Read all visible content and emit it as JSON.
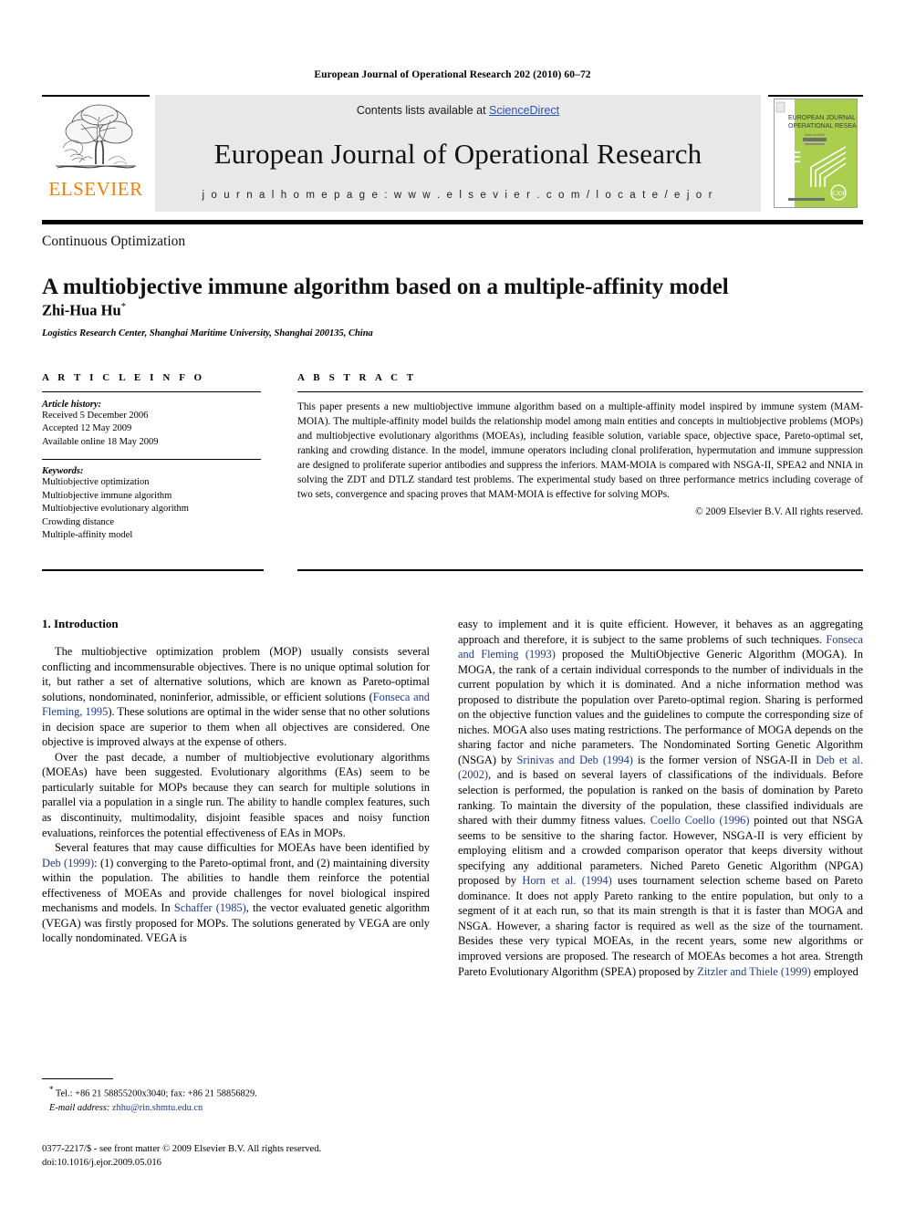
{
  "running_head": "European Journal of Operational Research 202 (2010) 60–72",
  "masthead": {
    "publisher_name": "ELSEVIER",
    "contents_prefix": "Contents lists available at ",
    "sciencedirect": "ScienceDirect",
    "journal_title": "European Journal of Operational Research",
    "homepage": "j o u r n a l   h o m e p a g e :   w w w . e l s e v i e r . c o m / l o c a t e / e j o r",
    "cover": {
      "line1": "EUROPEAN JOURNAL OF",
      "line2": "OPERATIONAL RESEARCH",
      "badge": "EJOR"
    },
    "link_color": "#2a53b8",
    "brand_color": "#F07F09",
    "cover_color": "#a8cc46"
  },
  "section_tag": "Continuous Optimization",
  "title": "A multiobjective immune algorithm based on a multiple-affinity model",
  "author": "Zhi-Hua Hu",
  "author_marker": "*",
  "affiliation": "Logistics Research Center, Shanghai Maritime University, Shanghai 200135, China",
  "article_info": {
    "heading": "A R T I C L E    I N F O",
    "history_label": "Article history:",
    "history": [
      "Received 5 December 2006",
      "Accepted 12 May 2009",
      "Available online 18 May 2009"
    ],
    "keywords_label": "Keywords:",
    "keywords": [
      "Multiobjective optimization",
      "Multiobjective immune algorithm",
      "Multiobjective evolutionary algorithm",
      "Crowding distance",
      "Multiple-affinity model"
    ]
  },
  "abstract": {
    "heading": "A B S T R A C T",
    "text": "This paper presents a new multiobjective immune algorithm based on a multiple-affinity model inspired by immune system (MAM-MOIA). The multiple-affinity model builds the relationship model among main entities and concepts in multiobjective problems (MOPs) and multiobjective evolutionary algorithms (MOEAs), including feasible solution, variable space, objective space, Pareto-optimal set, ranking and crowding distance. In the model, immune operators including clonal proliferation, hypermutation and immune suppression are designed to proliferate superior antibodies and suppress the inferiors. MAM-MOIA is compared with NSGA-II, SPEA2 and NNIA in solving the ZDT and DTLZ standard test problems. The experimental study based on three performance metrics including coverage of two sets, convergence and spacing proves that MAM-MOIA is effective for solving MOPs.",
    "copyright": "© 2009 Elsevier B.V. All rights reserved."
  },
  "body": {
    "section_number_title": "1. Introduction",
    "left_paragraphs": [
      "The multiobjective optimization problem (MOP) usually consists several conflicting and incommensurable objectives. There is no unique optimal solution for it, but rather a set of alternative solutions, which are known as Pareto-optimal solutions, nondominated, noninferior, admissible, or efficient solutions (Fonseca and Fleming, 1995). These solutions are optimal in the wider sense that no other solutions in decision space are superior to them when all objectives are considered. One objective is improved always at the expense of others.",
      "Over the past decade, a number of multiobjective evolutionary algorithms (MOEAs) have been suggested. Evolutionary algorithms (EAs) seem to be particularly suitable for MOPs because they can search for multiple solutions in parallel via a population in a single run. The ability to handle complex features, such as discontinuity, multimodality, disjoint feasible spaces and noisy function evaluations, reinforces the potential effectiveness of EAs in MOPs.",
      "Several features that may cause difficulties for MOEAs have been identified by Deb (1999): (1) converging to the Pareto-optimal front, and (2) maintaining diversity within the population. The abilities to handle them reinforce the potential effectiveness of MOEAs and provide challenges for novel biological inspired mechanisms and models. In Schaffer (1985), the vector evaluated genetic algorithm (VEGA) was firstly proposed for MOPs. The solutions generated by VEGA are only locally nondominated. VEGA is"
    ],
    "right_paragraphs": [
      "easy to implement and it is quite efficient. However, it behaves as an aggregating approach and therefore, it is subject to the same problems of such techniques. Fonseca and Fleming (1993) proposed the MultiObjective Generic Algorithm (MOGA). In MOGA, the rank of a certain individual corresponds to the number of individuals in the current population by which it is dominated. And a niche information method was proposed to distribute the population over Pareto-optimal region. Sharing is performed on the objective function values and the guidelines to compute the corresponding size of niches. MOGA also uses mating restrictions. The performance of MOGA depends on the sharing factor and niche parameters. The Nondominated Sorting Genetic Algorithm (NSGA) by Srinivas and Deb (1994) is the former version of NSGA-II in Deb et al. (2002), and is based on several layers of classifications of the individuals. Before selection is performed, the population is ranked on the basis of domination by Pareto ranking. To maintain the diversity of the population, these classified individuals are shared with their dummy fitness values. Coello Coello (1996) pointed out that NSGA seems to be sensitive to the sharing factor. However, NSGA-II is very efficient by employing elitism and a crowded comparison operator that keeps diversity without specifying any additional parameters. Niched Pareto Genetic Algorithm (NPGA) proposed by Horn et al. (1994) uses tournament selection scheme based on Pareto dominance. It does not apply Pareto ranking to the entire population, but only to a segment of it at each run, so that its main strength is that it is faster than MOGA and NSGA. However, a sharing factor is required as well as the size of the tournament. Besides these very typical MOEAs, in the recent years, some new algorithms or improved versions are proposed. The research of MOEAs becomes a hot area. Strength Pareto Evolutionary Algorithm (SPEA) proposed by Zitzler and Thiele (1999) employed"
    ],
    "citations": [
      "Fonseca and Fleming, 1995",
      "Deb (1999)",
      "Schaffer (1985)",
      "Fonseca and Fleming (1993)",
      "Srinivas and Deb (1994)",
      "Deb et al. (2002)",
      "Coello Coello (1996)",
      "Horn et al. (1994)",
      "Zitzler and Thiele (1999)"
    ],
    "citation_color": "#1b3a8f"
  },
  "footnote": {
    "contact": "Tel.: +86 21 58855200x3040; fax: +86 21 58856829.",
    "email_label": "E-mail address:",
    "email": "zhhu@rin.shmtu.edu.cn"
  },
  "imprint": {
    "line1": "0377-2217/$ - see front matter © 2009 Elsevier B.V. All rights reserved.",
    "line2": "doi:10.1016/j.ejor.2009.05.016"
  }
}
